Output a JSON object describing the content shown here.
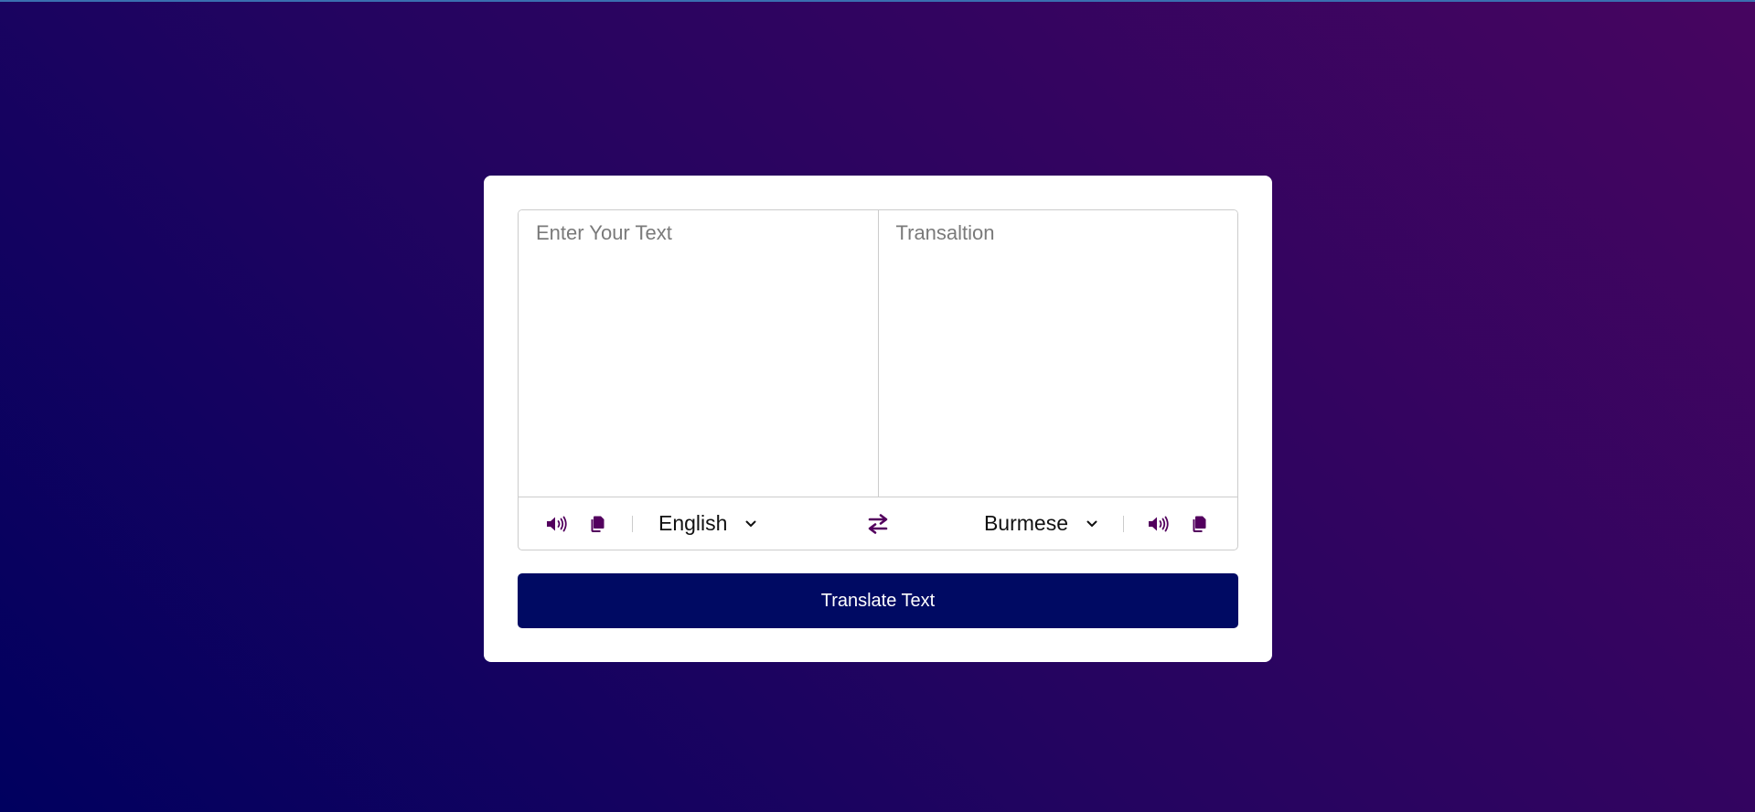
{
  "colors": {
    "accent": "#53005e",
    "button_bg": "#000a63",
    "background_start": "#00005f",
    "background_end": "#470560"
  },
  "source": {
    "placeholder": "Enter Your Text",
    "language": "English",
    "speak_icon": "volume-icon",
    "copy_icon": "copy-icon"
  },
  "target": {
    "placeholder": "Transaltion",
    "language": "Burmese",
    "speak_icon": "volume-icon",
    "copy_icon": "copy-icon"
  },
  "exchange_icon": "exchange-arrows-icon",
  "translate_button": {
    "label": "Translate Text"
  }
}
